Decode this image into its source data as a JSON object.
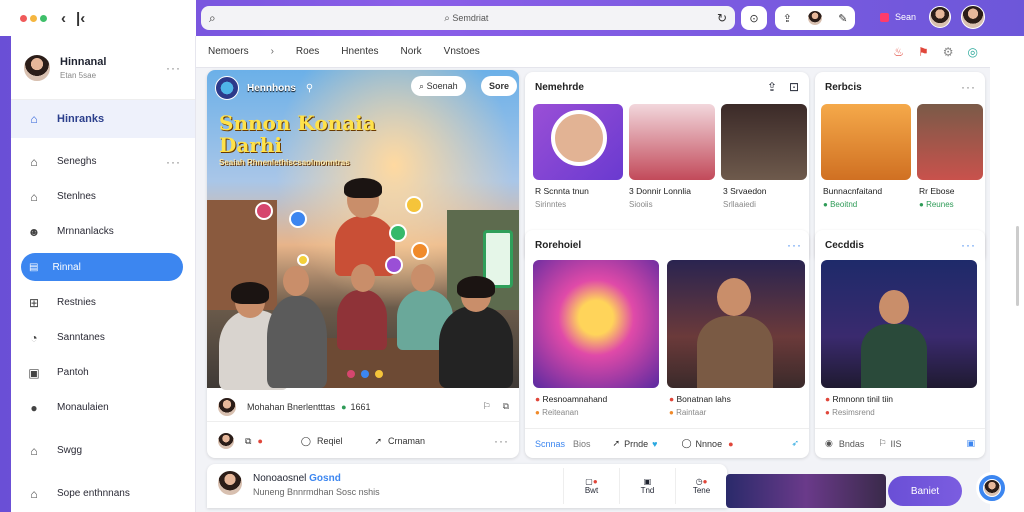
{
  "window": {
    "traffic_colors": [
      "#f05a5a",
      "#f5b640",
      "#3fbf6a"
    ],
    "back_icon": "chevron-left-icon",
    "forward_icon": "chevron-left-bar-icon"
  },
  "search": {
    "placeholder": "Semdriat",
    "left_icon": "search-icon",
    "refresh_icon": "refresh-icon"
  },
  "topright": {
    "label": "Sean"
  },
  "sidebar": {
    "profile": {
      "name": "Hinnanal",
      "sub": "Etan 5sae"
    },
    "home": "Hinranks",
    "items": [
      "Seneghs",
      "Stenlnes",
      "Mrnnanlacks",
      "Rinnal",
      "Restnies",
      "Sanntanes",
      "Pantoh",
      "Monaulaien",
      "Swgg",
      "Sope enthnnans"
    ],
    "active_index": 3
  },
  "subnav": {
    "tabs": [
      "Nemoers",
      "Roes",
      "Hnentes",
      "Nork",
      "Vnstoes"
    ]
  },
  "hero": {
    "channel": "Hennhons",
    "title_line1": "Snnon Konaia",
    "title_line2": "Darhi",
    "subtitle": "Seaiah Rhnenlethiscsaolmonntras",
    "search_pill": "Soenah",
    "sub_pill": "Sore",
    "author": "Mohahan Bnerlentttas",
    "author_count": "1661",
    "actions": [
      "Reqiel",
      "Crnaman"
    ]
  },
  "card_top_mid": {
    "title": "Nemehrde",
    "items": [
      {
        "title": "Scnnta tnun",
        "sub": "Sirinntes",
        "prefix": "R"
      },
      {
        "title": "Donnir Lonnlia",
        "sub": "Siooiis",
        "prefix": "3"
      },
      {
        "title": "Srvaedon",
        "sub": "Srllaaiedi",
        "prefix": "3"
      }
    ]
  },
  "card_top_right": {
    "title": "Rerbcis",
    "items": [
      {
        "title": "Bunnacnfaitand",
        "sub": "Beoitnd"
      },
      {
        "title": "Rr Ebose",
        "sub": "Reunes"
      }
    ]
  },
  "card_mid_mid": {
    "title": "Rorehoiel",
    "items": [
      {
        "title": "Resnoamnahand",
        "sub": "Reiteanan"
      },
      {
        "title": "Bonatnan lahs",
        "sub": "Raintaar"
      }
    ],
    "footer": [
      "Scnnas",
      "Bios",
      "Prnde",
      "Nnnoe"
    ]
  },
  "card_mid_right": {
    "title": "Cecddis",
    "items": [
      {
        "title": "Rmnonn tinil tiin",
        "sub": "Resimsrend"
      }
    ],
    "footer": [
      "Bndas",
      "IIS"
    ]
  },
  "bottom_bar": {
    "name": "Nonoaosnel",
    "tag": "Gosnd",
    "sub": "Nuneng Bnnrmdhan Sosc nshis",
    "buttons": [
      "Bwt",
      "Tnd",
      "Tene"
    ],
    "cta": "Baniet"
  }
}
